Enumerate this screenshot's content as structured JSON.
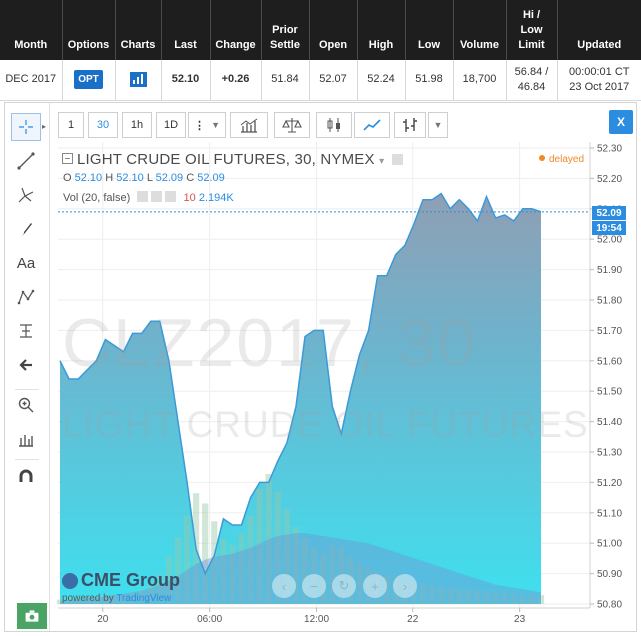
{
  "table": {
    "headers": [
      "Month",
      "Options",
      "Charts",
      "Last",
      "Change",
      "Prior Settle",
      "Open",
      "High",
      "Low",
      "Volume",
      "Hi / Low Limit",
      "Updated"
    ],
    "row": {
      "month": "DEC 2017",
      "options": "OPT",
      "last": "52.10",
      "change": "+0.26",
      "prior_settle": "51.84",
      "open": "52.07",
      "high": "52.24",
      "low": "51.98",
      "volume": "18,700",
      "limit_hi": "56.84 /",
      "limit_lo": "46.84",
      "updated_time": "00:00:01 CT",
      "updated_date": "23 Oct 2017"
    }
  },
  "toolbar": {
    "intervals": [
      "1",
      "30",
      "1h",
      "1D"
    ],
    "selected_interval": "30",
    "close_label": "X"
  },
  "legend": {
    "title": "LIGHT CRUDE OIL FUTURES, 30, NYMEX",
    "o_label": "O",
    "o": "52.10",
    "h_label": "H",
    "h": "52.10",
    "l_label": "L",
    "l": "52.09",
    "c_label": "C",
    "c": "52.09",
    "vol_label": "Vol (20, false)",
    "vol_a": "10",
    "vol_b": "2.194K",
    "delayed": "delayed"
  },
  "watermark": {
    "line1": "CLZ2017, 30",
    "line2": "LIGHT CRUDE OIL FUTURES"
  },
  "branding": {
    "name": "CME Group",
    "powered_prefix": "powered by",
    "powered_name": "TradingView"
  },
  "badges": {
    "price": "52.09",
    "time": "19:54"
  },
  "colors": {
    "accent": "#2c8de0",
    "area_line": "#3a9ad9",
    "positive": "#2a9e2a",
    "delayed": "#f08a24",
    "camera": "#4aa564"
  },
  "chart_data": {
    "type": "area",
    "title": "LIGHT CRUDE OIL FUTURES, 30, NYMEX",
    "x_ticks": [
      "20",
      "06:00",
      "12:00",
      "22",
      "23"
    ],
    "y_ticks": [
      "52.30",
      "52.20",
      "52.10",
      "52.00",
      "51.90",
      "51.80",
      "51.70",
      "51.60",
      "51.50",
      "51.40",
      "51.30",
      "51.20",
      "51.10",
      "51.00",
      "50.90",
      "50.80"
    ],
    "ylim": [
      50.8,
      52.3
    ],
    "x_index_range": [
      0,
      45
    ],
    "x_tick_index": [
      4,
      14,
      24,
      33,
      43
    ],
    "price": [
      51.6,
      51.54,
      51.54,
      51.57,
      51.6,
      51.67,
      51.65,
      51.63,
      51.69,
      51.69,
      51.73,
      51.73,
      51.6,
      51.4,
      51.2,
      50.98,
      50.9,
      50.96,
      51.08,
      51.06,
      51.06,
      51.15,
      51.2,
      51.2,
      51.27,
      51.33,
      51.45,
      51.68,
      51.7,
      51.7,
      51.45,
      51.36,
      51.5,
      51.62,
      51.7,
      51.88,
      51.88,
      51.95,
      51.98,
      52.05,
      52.13,
      52.13,
      52.15,
      52.1,
      52.13,
      52.1,
      52.06,
      52.14,
      52.07,
      52.08,
      52.06,
      52.1,
      52.1,
      52.09
    ],
    "volume_note": "",
    "volume": [
      3,
      4,
      4,
      5,
      5,
      6,
      6,
      7,
      8,
      10,
      14,
      20,
      32,
      45,
      60,
      75,
      68,
      56,
      44,
      40,
      48,
      60,
      78,
      88,
      76,
      64,
      52,
      44,
      38,
      34,
      40,
      38,
      32,
      28,
      24,
      22,
      20,
      18,
      16,
      15,
      14,
      13,
      12,
      11,
      10,
      10,
      9,
      8,
      8,
      7,
      7,
      6,
      6,
      6
    ],
    "volume_ma": [
      2,
      3,
      3,
      4,
      4,
      5,
      6,
      7,
      8,
      9,
      11,
      13,
      16,
      19,
      23,
      27,
      30,
      32,
      33,
      34,
      36,
      38,
      41,
      44,
      46,
      47,
      48,
      48,
      47,
      46,
      45,
      44,
      43,
      42,
      41,
      39,
      37,
      35,
      33,
      31,
      29,
      27,
      25,
      23,
      21,
      19,
      17,
      15,
      13,
      12,
      11,
      10,
      9,
      8
    ],
    "last_price": 52.09,
    "last_time": "19:54"
  }
}
